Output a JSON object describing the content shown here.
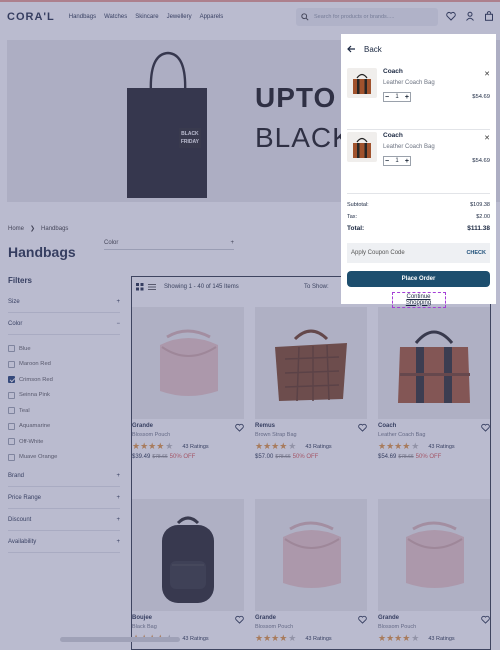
{
  "header": {
    "logo": "CORA'L",
    "nav": [
      "Handbags",
      "Watches",
      "Skincare",
      "Jewellery",
      "Apparels"
    ],
    "search_placeholder": "Search for products or brands....."
  },
  "hero": {
    "line1": "UPTO",
    "line2": "BLACK",
    "bag_label_1": "BLACK",
    "bag_label_2": "FRIDAY"
  },
  "breadcrumb": {
    "home": "Home",
    "current": "Handbags"
  },
  "page_title": "Handbags",
  "color_dropdown": "Color",
  "filters": {
    "title": "Filters",
    "size": "Size",
    "color": "Color",
    "colors": [
      "Blue",
      "Maroon Red",
      "Crimson Red",
      "Seinna Pink",
      "Teal",
      "Aquamarine",
      "Off-White",
      "Muave Orange"
    ],
    "checked_color": "Crimson Red",
    "brand": "Brand",
    "price_range": "Price Range",
    "discount": "Discount",
    "availability": "Availability"
  },
  "listing": {
    "count_text": "Showing 1 - 40 of 145 Items",
    "show_label": "To Show:",
    "products": [
      {
        "name": "Grande",
        "sub": "Blossom Pouch",
        "ratings": "43 Ratings",
        "price": "$39.49",
        "old": "$78.66",
        "off": "50% OFF"
      },
      {
        "name": "Remus",
        "sub": "Brown Strap Bag",
        "ratings": "43 Ratings",
        "price": "$57.00",
        "old": "$78.66",
        "off": "50% OFF"
      },
      {
        "name": "Coach",
        "sub": "Leather Coach Bag",
        "ratings": "43 Ratings",
        "price": "$54.69",
        "old": "$78.66",
        "off": "50% OFF"
      },
      {
        "name": "Boujee",
        "sub": "Black Bag",
        "ratings": "43 Ratings",
        "price": "",
        "old": "",
        "off": ""
      },
      {
        "name": "Grande",
        "sub": "Blossom Pouch",
        "ratings": "43 Ratings",
        "price": "",
        "old": "",
        "off": ""
      },
      {
        "name": "Grande",
        "sub": "Blossom Pouch",
        "ratings": "43 Ratings",
        "price": "",
        "old": "",
        "off": ""
      }
    ]
  },
  "cart": {
    "back": "Back",
    "items": [
      {
        "name": "Coach",
        "sub": "Leather Coach Bag",
        "qty": "1",
        "price": "$54.69"
      },
      {
        "name": "Coach",
        "sub": "Leather Coach Bag",
        "qty": "1",
        "price": "$54.69"
      }
    ],
    "subtotal_label": "Subtotal:",
    "subtotal": "$109.38",
    "tax_label": "Tax:",
    "tax": "$2.00",
    "total_label": "Total:",
    "total": "$111.38",
    "coupon_placeholder": "Apply Coupon Code",
    "coupon_check": "CHECK",
    "place_order": "Place Order",
    "continue": "Continue Shopping"
  },
  "colors": {
    "accent": "#1d4e6e",
    "overlay": "#5a5e8c",
    "star": "#e0913a",
    "sale": "#d9534f"
  }
}
